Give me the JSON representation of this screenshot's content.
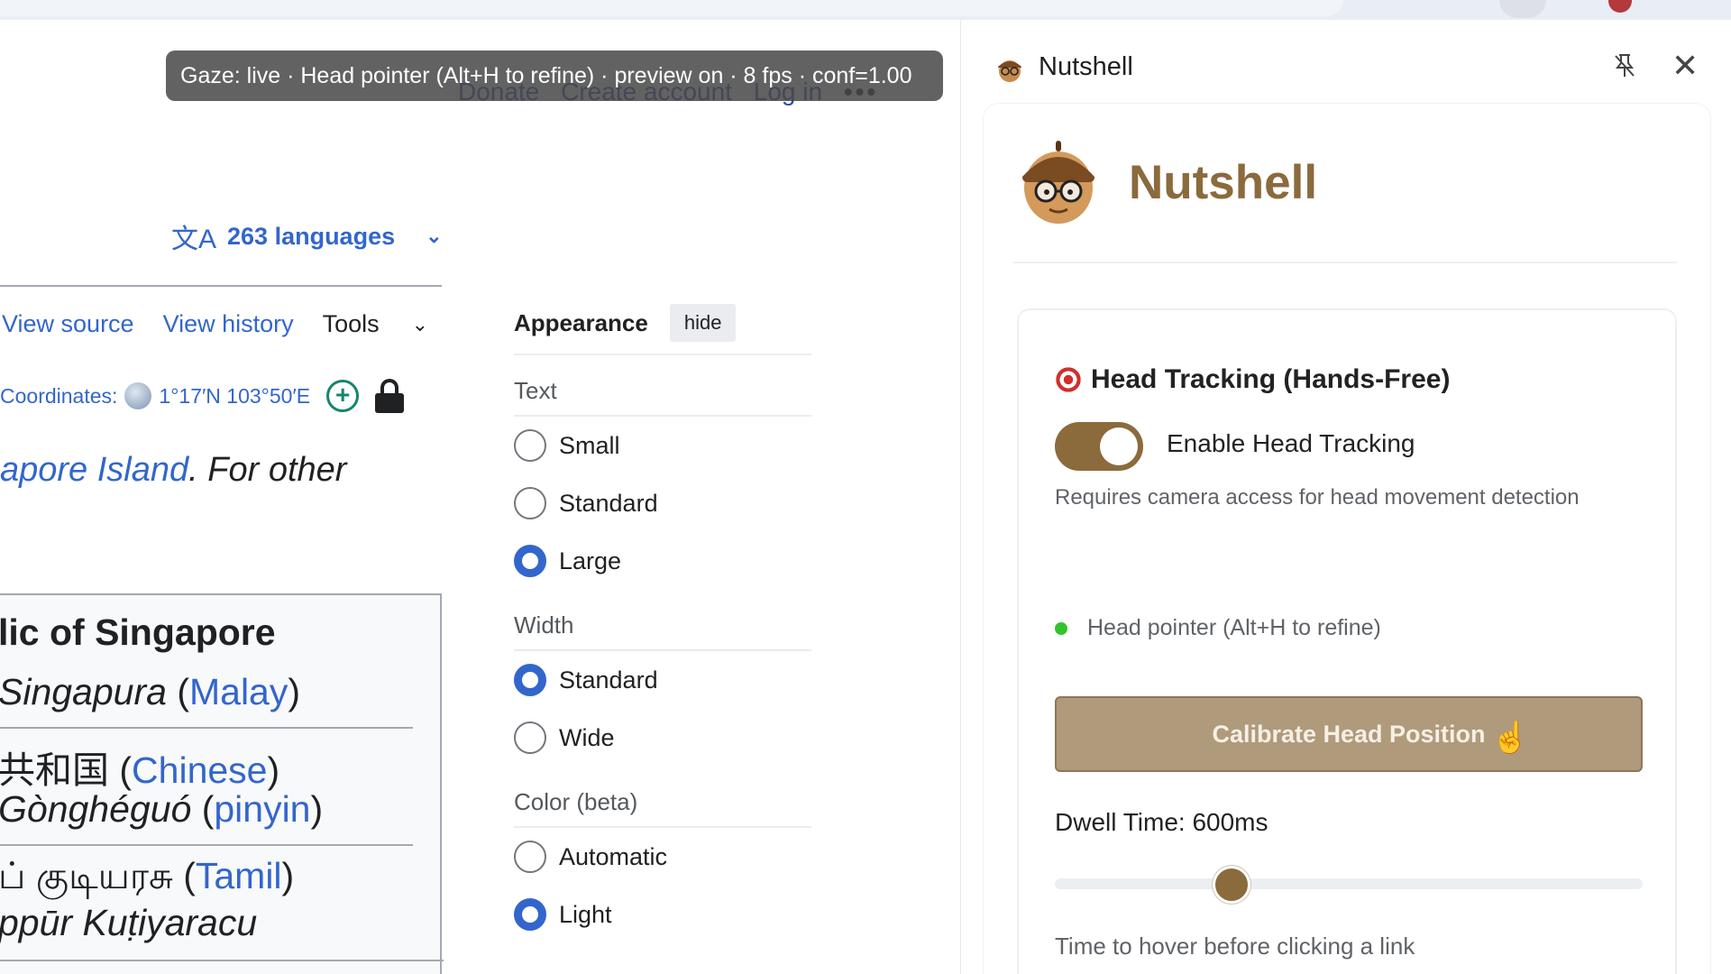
{
  "gaze_bar": "Gaze: live · Head pointer (Alt+H to refine) · preview on · 8 fps · conf=1.00",
  "wiki": {
    "top_links": [
      "Donate",
      "Create account",
      "Log in"
    ],
    "more": "•••",
    "languages": "263 languages",
    "tabs": [
      "View source",
      "View history"
    ],
    "tools": "Tools",
    "coords_label": "Coordinates:",
    "coords_value": "1°17′N 103°50′E",
    "hatnote_link": "apore Island",
    "hatnote_rest": ". For other",
    "infobox": {
      "title": "lic of Singapore",
      "malay_name": "Singapura",
      "malay_lang": "Malay",
      "chinese_name": "共和国",
      "chinese_lang": "Chinese",
      "pinyin_name": "Gònghéguó",
      "pinyin_lang": "pinyin",
      "tamil_name": "ப் குடியரசு",
      "tamil_lang": "Tamil",
      "tamil_roman": "ppūr Kuṭiyaracu"
    }
  },
  "appearance": {
    "title": "Appearance",
    "hide_label": "hide",
    "text_group": "Text",
    "text_options": [
      {
        "label": "Small",
        "selected": false
      },
      {
        "label": "Standard",
        "selected": false
      },
      {
        "label": "Large",
        "selected": true
      }
    ],
    "width_group": "Width",
    "width_options": [
      {
        "label": "Standard",
        "selected": true
      },
      {
        "label": "Wide",
        "selected": false
      }
    ],
    "color_group": "Color (beta)",
    "color_options": [
      {
        "label": "Automatic",
        "selected": false
      },
      {
        "label": "Light",
        "selected": true
      }
    ]
  },
  "panel": {
    "header_title": "Nutshell",
    "brand_name": "Nutshell",
    "section_title": "Head Tracking (Hands-Free)",
    "toggle_label": "Enable Head Tracking",
    "toggle_on": true,
    "help_text": "Requires camera access for head movement detection",
    "status_text": "Head pointer (Alt+H to refine)",
    "calibrate_label": "Calibrate Head Position",
    "dwell_label": "Dwell Time: 600ms",
    "dwell_ms": 600,
    "dwell_help": "Time to hover before clicking a link"
  },
  "colors": {
    "accent": "#8b6a3c",
    "link": "#3366cc",
    "status_ok": "#34c32a"
  }
}
